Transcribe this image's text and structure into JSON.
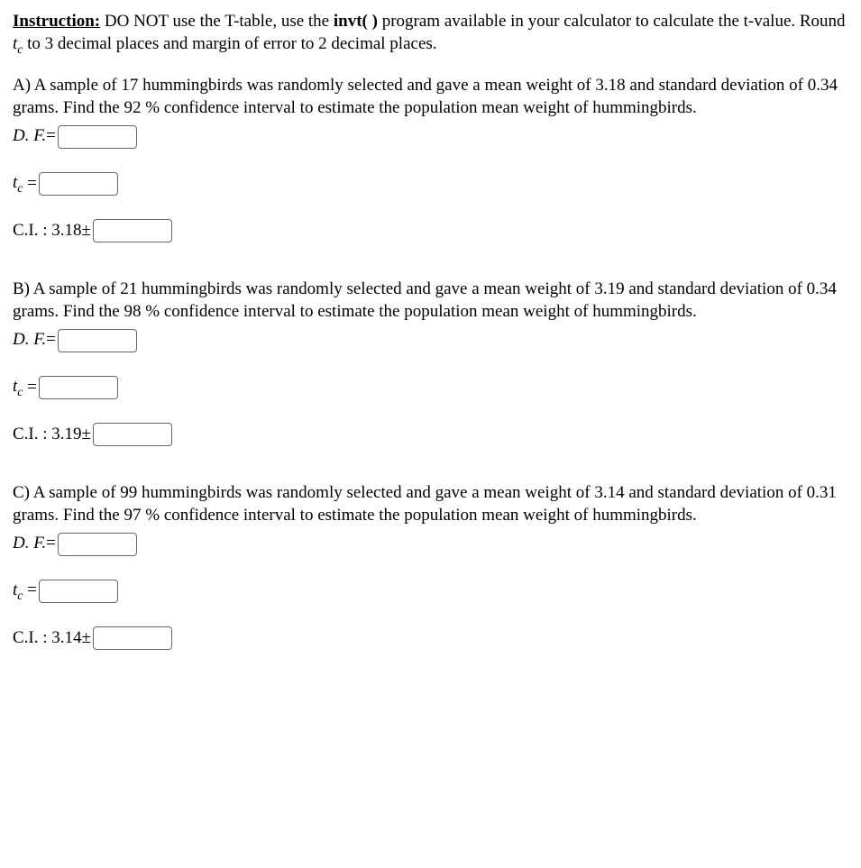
{
  "instruction": {
    "label": "Instruction:",
    "part1": " DO NOT use the T-table, use the ",
    "invt": "invt( )",
    "part2": " program available in your calculator to calculate the t-value. Round ",
    "tc": "t",
    "tc_sub": "c",
    "part3": " to 3 decimal places and margin of error to 2 decimal places."
  },
  "labels": {
    "df": "D. F.",
    "eq": "=",
    "tc_t": "t",
    "tc_c": "c",
    "ci_prefix": "C.I. : ",
    "pm": "±"
  },
  "problems": [
    {
      "letter": "A)",
      "text": " A sample of 17 hummingbirds was randomly selected and gave a mean weight of 3.18 and standard deviation of 0.34 grams. Find the 92 % confidence interval to estimate the population mean weight of hummingbirds.",
      "ci_mean": "3.18"
    },
    {
      "letter": "B)",
      "text": " A sample of 21 hummingbirds was randomly selected and gave a mean weight of 3.19 and standard deviation of 0.34 grams. Find the 98 % confidence interval to estimate the population mean weight of hummingbirds.",
      "ci_mean": "3.19"
    },
    {
      "letter": "C)",
      "text": " A sample of 99 hummingbirds was randomly selected and gave a mean weight of 3.14 and standard deviation of 0.31 grams. Find the 97 % confidence interval to estimate the population mean weight of hummingbirds.",
      "ci_mean": "3.14"
    }
  ]
}
